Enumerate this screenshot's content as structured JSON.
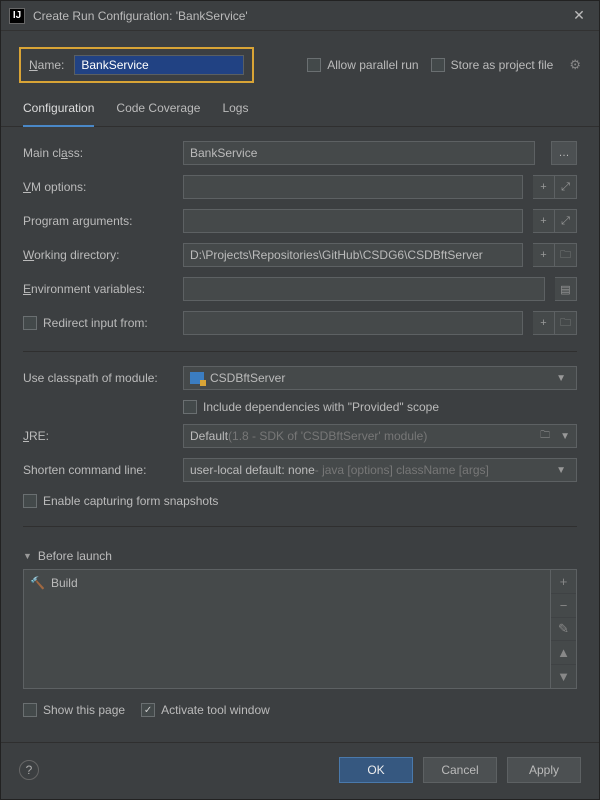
{
  "window": {
    "title": "Create Run Configuration: 'BankService'"
  },
  "header": {
    "name_label": "Name:",
    "name_value": "BankService",
    "allow_parallel": "Allow parallel run",
    "store_project": "Store as project file"
  },
  "tabs": {
    "configuration": "Configuration",
    "coverage": "Code Coverage",
    "logs": "Logs"
  },
  "form": {
    "main_class_label": "Main class:",
    "main_class_value": "BankService",
    "vm_options_label": "VM options:",
    "vm_options_value": "",
    "program_args_label": "Program arguments:",
    "program_args_value": "",
    "working_dir_label": "Working directory:",
    "working_dir_value": "D:\\Projects\\Repositories\\GitHub\\CSDG6\\CSDBftServer",
    "env_vars_label": "Environment variables:",
    "env_vars_value": "",
    "redirect_input_label": "Redirect input from:",
    "redirect_input_value": "",
    "classpath_label": "Use classpath of module:",
    "classpath_value": "CSDBftServer",
    "include_provided": "Include dependencies with \"Provided\" scope",
    "jre_label": "JRE:",
    "jre_prefix": "Default",
    "jre_hint": " (1.8 - SDK of 'CSDBftServer' module)",
    "shorten_label": "Shorten command line:",
    "shorten_prefix": "user-local default: none",
    "shorten_hint": " - java [options] className [args]",
    "enable_snapshots": "Enable capturing form snapshots"
  },
  "before_launch": {
    "title": "Before launch",
    "items": [
      "Build"
    ]
  },
  "footer": {
    "show_page": "Show this page",
    "activate_window": "Activate tool window",
    "ok": "OK",
    "cancel": "Cancel",
    "apply": "Apply"
  }
}
